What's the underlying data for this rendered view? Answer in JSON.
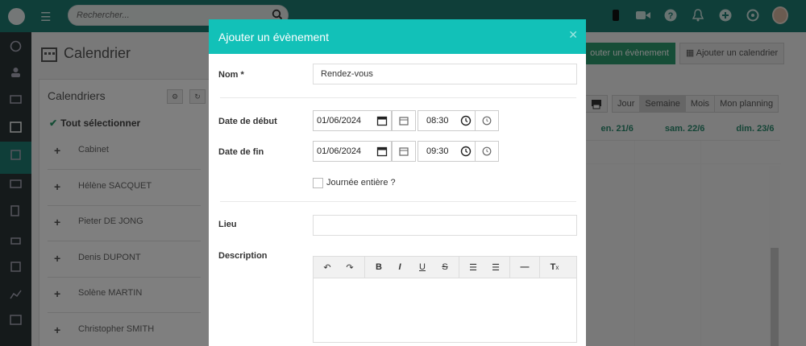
{
  "topbar": {
    "search_placeholder": "Rechercher..."
  },
  "page": {
    "title": "Calendrier",
    "add_event_label": "outer un évènement",
    "add_calendar_label": "Ajouter un calendrier",
    "views": [
      "Jour",
      "Semaine",
      "Mois",
      "Mon planning"
    ],
    "active_view": "Semaine",
    "day_headers": [
      "en. 21/6",
      "sam. 22/6",
      "dim. 23/6"
    ]
  },
  "calendars": {
    "header": "Calendriers",
    "select_all": "Tout sélectionner",
    "items": [
      "Cabinet",
      "Hélène SACQUET",
      "Pieter DE JONG",
      "Denis DUPONT",
      "Solène MARTIN",
      "Christopher SMITH"
    ]
  },
  "modal": {
    "title": "Ajouter un évènement",
    "close_icon": "close-icon",
    "name_label": "Nom *",
    "name_value": "Rendez-vous",
    "start_label": "Date de début",
    "start_date": "01/06/2024",
    "start_time": "08:30",
    "end_label": "Date de fin",
    "end_date": "01/06/2024",
    "end_time": "09:30",
    "all_day_label": "Journée entière ?",
    "all_day_checked": false,
    "location_label": "Lieu",
    "location_value": "",
    "description_label": "Description",
    "editor_tools": [
      {
        "name": "undo-icon",
        "glyph": "↶"
      },
      {
        "name": "redo-icon",
        "glyph": "↷"
      },
      {
        "name": "bold-icon",
        "glyph": "B"
      },
      {
        "name": "italic-icon",
        "glyph": "I"
      },
      {
        "name": "underline-icon",
        "glyph": "U"
      },
      {
        "name": "strikethrough-icon",
        "glyph": "S"
      },
      {
        "name": "bullet-list-icon",
        "glyph": "☰"
      },
      {
        "name": "numbered-list-icon",
        "glyph": "☰"
      },
      {
        "name": "horizontal-rule-icon",
        "glyph": "—"
      },
      {
        "name": "clear-format-icon",
        "glyph": "T"
      }
    ]
  },
  "colors": {
    "topbar": "#1e7c73",
    "modal_header": "#12c1b8",
    "accent_green": "#2d9a6e",
    "rail": "#2a3437"
  }
}
